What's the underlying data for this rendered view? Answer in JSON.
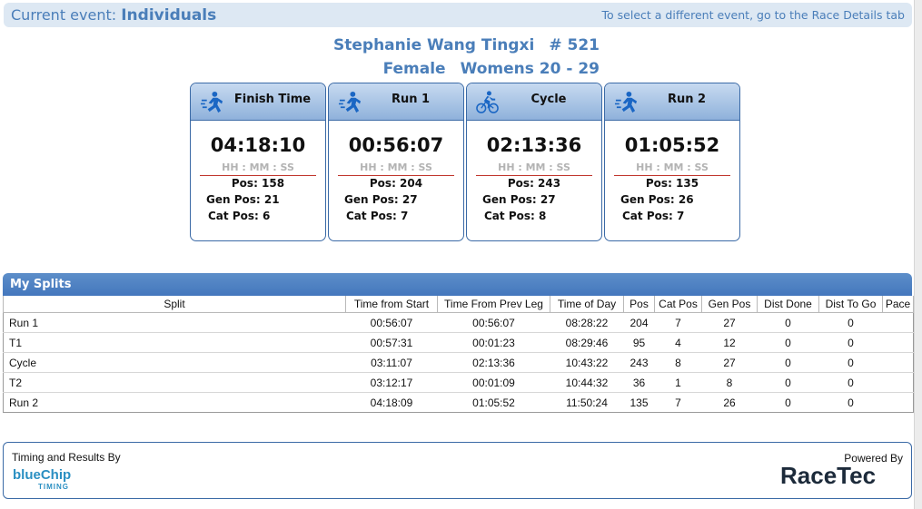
{
  "topbar": {
    "prefix": "Current event:",
    "event": "Individuals",
    "hint": "To select a different event, go to the Race Details tab"
  },
  "athlete": {
    "name": "Stephanie Wang Tingxi",
    "bib": "# 521",
    "gender": "Female",
    "category": "Womens 20 - 29"
  },
  "time_format": "HH : MM : SS",
  "cards": [
    {
      "icon": "runner-icon",
      "title": "Finish Time",
      "time": "04:18:10",
      "pos": "Pos: 158",
      "gen": "Gen Pos: 21",
      "cat": "Cat Pos: 6"
    },
    {
      "icon": "runner-icon",
      "title": "Run 1",
      "time": "00:56:07",
      "pos": "Pos: 204",
      "gen": "Gen Pos: 27",
      "cat": "Cat Pos: 7"
    },
    {
      "icon": "cyclist-icon",
      "title": "Cycle",
      "time": "02:13:36",
      "pos": "Pos: 243",
      "gen": "Gen Pos: 27",
      "cat": "Cat Pos: 8"
    },
    {
      "icon": "runner-icon",
      "title": "Run 2",
      "time": "01:05:52",
      "pos": "Pos: 135",
      "gen": "Gen Pos: 26",
      "cat": "Cat Pos: 7"
    }
  ],
  "splits": {
    "title": "My Splits",
    "columns": [
      "Split",
      "Time from Start",
      "Time From Prev Leg",
      "Time of Day",
      "Pos",
      "Cat Pos",
      "Gen Pos",
      "Dist Done",
      "Dist To Go",
      "Pace"
    ],
    "rows": [
      [
        "Run 1",
        "00:56:07",
        "00:56:07",
        "08:28:22",
        "204",
        "7",
        "27",
        "0",
        "0",
        ""
      ],
      [
        "T1",
        "00:57:31",
        "00:01:23",
        "08:29:46",
        "95",
        "4",
        "12",
        "0",
        "0",
        ""
      ],
      [
        "Cycle",
        "03:11:07",
        "02:13:36",
        "10:43:22",
        "243",
        "8",
        "27",
        "0",
        "0",
        ""
      ],
      [
        "T2",
        "03:12:17",
        "00:01:09",
        "10:44:32",
        "36",
        "1",
        "8",
        "0",
        "0",
        ""
      ],
      [
        "Run 2",
        "04:18:09",
        "01:05:52",
        "11:50:24",
        "135",
        "7",
        "26",
        "0",
        "0",
        ""
      ]
    ]
  },
  "footer": {
    "timing_by": "Timing and Results By",
    "bluechip_main": "blueChip",
    "bluechip_sub": "TIMING",
    "powered_by": "Powered By",
    "racetec": "RaceTec"
  },
  "colors": {
    "accent": "#4a7eb9",
    "card_border": "#3b6aa6",
    "header_bar": "#4477bd",
    "divider_red": "#c0362c"
  }
}
